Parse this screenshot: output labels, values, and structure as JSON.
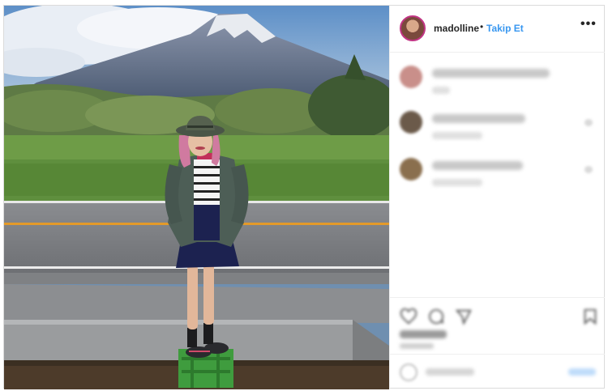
{
  "header": {
    "username": "madolline",
    "separator": "•",
    "follow_label": "Takip Et",
    "more_label": "•••"
  },
  "comments": [
    {
      "avatar_color": "#c98f8a"
    },
    {
      "avatar_color": "#6b5a4a"
    },
    {
      "avatar_color": "#8a6f4e"
    }
  ],
  "colors": {
    "follow_blue": "#3897f0",
    "story_ring": "#c13584",
    "border": "#dbdbdb"
  },
  "icons": [
    "heart-icon",
    "comment-icon",
    "share-icon",
    "bookmark-icon",
    "emoji-icon",
    "more-options-icon"
  ]
}
